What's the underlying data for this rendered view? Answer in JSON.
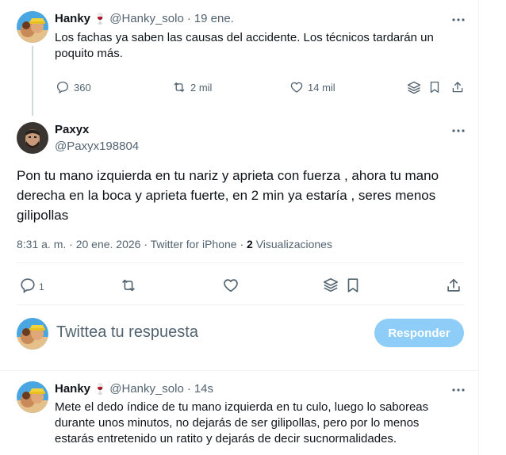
{
  "tweet1": {
    "author_name": "Hanky",
    "author_emoji": "🍷",
    "handle": "@Hanky_solo",
    "dot": "·",
    "date": "19 ene.",
    "text": "Los fachas ya saben las causas del accidente. Los técnicos tardarán un poquito más.",
    "replies": "360",
    "retweets": "2 mil",
    "likes": "14 mil"
  },
  "tweet2": {
    "author_name": "Paxyx",
    "handle": "@Paxyx198804",
    "text": "Pon tu mano izquierda en tu nariz y aprieta con fuerza , ahora tu mano derecha en la boca y aprieta fuerte, en 2 min ya estaría , seres menos gilipollas",
    "meta_time": "8:31 a. m. · 20 ene. 2026 · Twitter for iPhone ·",
    "views_count": "2",
    "views_label": "Visualizaciones",
    "replies": "1"
  },
  "composer": {
    "placeholder": "Twittea tu respuesta",
    "button": "Responder"
  },
  "tweet3": {
    "author_name": "Hanky",
    "author_emoji": "🍷",
    "handle": "@Hanky_solo",
    "dot": "·",
    "date": "14s",
    "text": "Mete el dedo índice de tu mano izquierda en tu culo, luego lo saboreas durante unos minutos, no dejarás de ser gilipollas, pero por lo menos estarás entretenido un ratito y dejarás de decir sucnormalidades."
  },
  "colors": {
    "accent": "#1d9bf0",
    "accent_disabled": "#8ecdf8",
    "muted": "#536471",
    "border": "#eff3f4"
  }
}
